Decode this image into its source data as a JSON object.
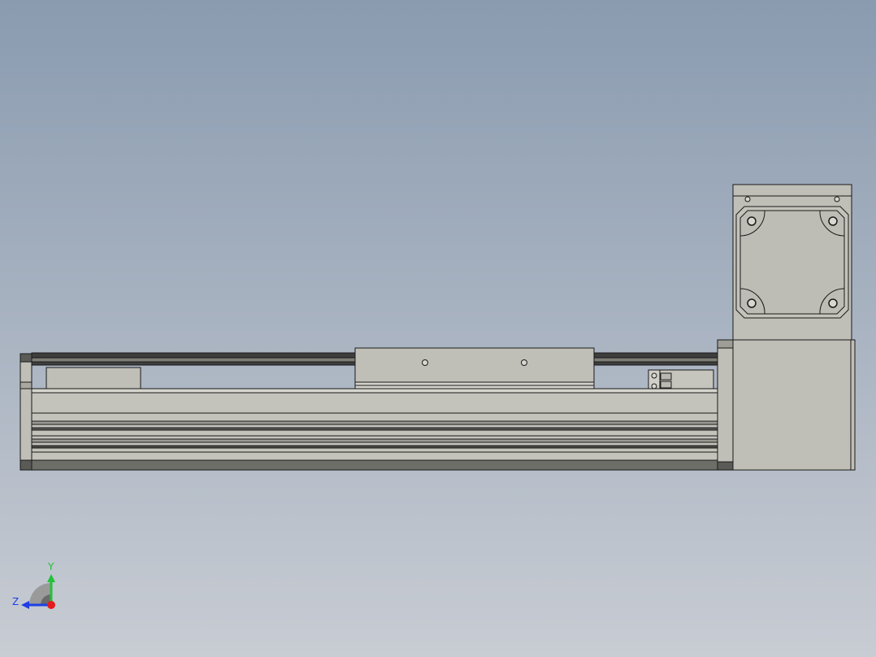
{
  "viewport": {
    "background_top": "#8a9bb0",
    "background_bottom": "#c8ccd3"
  },
  "colors": {
    "part_face": "#c0bfb7",
    "part_light": "#cfcec7",
    "outline": "#1a1a1a",
    "dark_rail": "#4a4a4a",
    "mid_gray": "#808078"
  },
  "triad": {
    "y_label": "Y",
    "z_label": "Z",
    "y_color": "#22c23a",
    "z_color": "#1f3ee6",
    "x_color": "#e41c1c"
  }
}
